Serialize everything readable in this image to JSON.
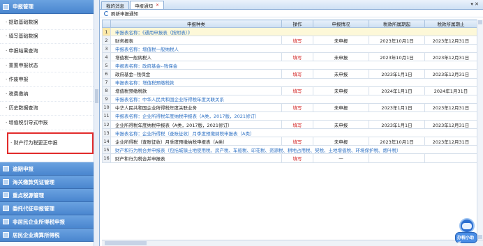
{
  "sidebar": {
    "header": "申报管理",
    "items": [
      "· 提取基础数据",
      "· 填写基础数据",
      "· 申报结果查询",
      "· 重置申报状态",
      "· 作废申报",
      "· 税费缴纳",
      "· 历史数据查询",
      "· 增值税引导式申报",
      "· 财产行为税更正申报"
    ],
    "groups": [
      "逾期申报",
      "海关缴款凭证管理",
      "重点税源管理",
      "委托代征申报管理",
      "非居民企业所得税申报",
      "居民企业清算所得税"
    ]
  },
  "tabs": {
    "my_messages": "我的消息",
    "declare_notice": "申报通知",
    "close_glyph": "✕",
    "menu_glyph": "▾ ✕"
  },
  "toolbar": {
    "refresh": "刷新申报通知"
  },
  "table": {
    "headers": [
      "申报种类",
      "操作",
      "申报情况",
      "税款所属期起",
      "税款所属期止"
    ],
    "action_label": "填写",
    "rows": [
      {
        "n": "1",
        "name": "申报表名称：《通用申报表（按附表）》",
        "cat": true,
        "first": true
      },
      {
        "n": "2",
        "name": "财务报表",
        "op": "填写",
        "status": "未申报",
        "from": "2023年10月1日",
        "to": "2023年12月31日"
      },
      {
        "n": "3",
        "name": "申报表名称：增值税一般纳税人",
        "cat": true
      },
      {
        "n": "4",
        "name": "增值税一般纳税人",
        "op": "填写",
        "status": "未申报",
        "from": "2023年10月1日",
        "to": "2023年12月31日"
      },
      {
        "n": "5",
        "name": "申报表名称：政府基金--残保金",
        "cat": true
      },
      {
        "n": "6",
        "name": "政府基金--残保金",
        "op": "填写",
        "status": "未申报",
        "from": "2023年1月1日",
        "to": "2023年12月31日"
      },
      {
        "n": "7",
        "name": "申报表名称：增值税预缴税款",
        "cat": true
      },
      {
        "n": "8",
        "name": "增值税预缴税款",
        "op": "填写",
        "status": "未申报",
        "from": "2024年1月1日",
        "to": "2024年1月31日"
      },
      {
        "n": "9",
        "name": "申报表名称：中华人民共和国企业所得税年度关联关系",
        "cat": true
      },
      {
        "n": "10",
        "name": "中华人民共和国企业所得税年度关联业务",
        "op": "填写",
        "status": "未申报",
        "from": "2023年1月1日",
        "to": "2023年12月31日"
      },
      {
        "n": "11",
        "name": "申报表名称：企业所得税年度纳税申报表（A类，2017版，2021修订）",
        "cat": true
      },
      {
        "n": "12",
        "name": "企业所得税年度纳税申报表（A类，2017版，2021修订）",
        "op": "填写",
        "status": "未申报",
        "from": "2023年1月1日",
        "to": "2023年12月31日"
      },
      {
        "n": "13",
        "name": "申报表名称：企业所得税（查账征收）月季度预缴纳税申报表（A类）",
        "cat": true
      },
      {
        "n": "14",
        "name": "企业所得税（查账征收）月季度预缴纳税申报表（A类）",
        "op": "填写",
        "status": "未申报",
        "from": "2023年10月1日",
        "to": "2023年12月31日"
      },
      {
        "n": "15",
        "name": "财产和行为税合并申报表（包括城镇土地使用税、房产税、车船税、印花税、资源税、耕地占用税、契税、土地增值税、环境保护税、烟叶税）",
        "cat": true
      },
      {
        "n": "16",
        "name": "财产和行为税合并申报表",
        "op": "填写",
        "status": "—",
        "from": "",
        "to": ""
      }
    ]
  },
  "helper_label": "办税小助手",
  "colors": {
    "accent": "#4a86cf",
    "category_text": "#2f72c4",
    "action_text": "#d01a1a",
    "highlight_border": "#e22b2b"
  }
}
